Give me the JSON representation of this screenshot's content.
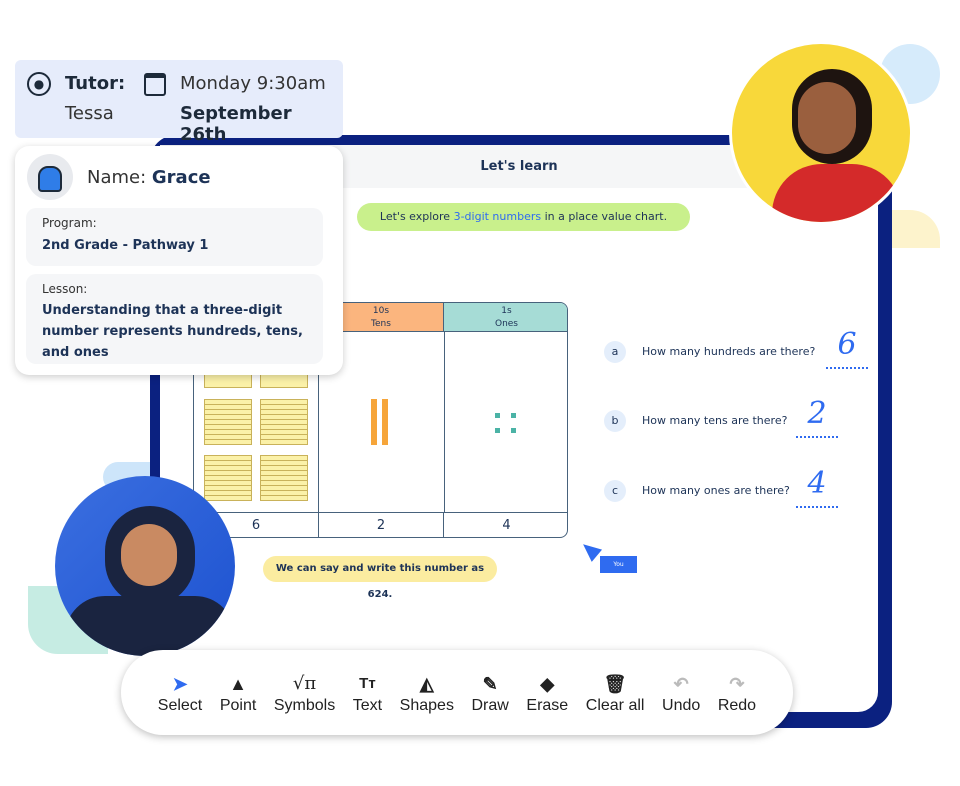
{
  "tutor": {
    "label": "Tutor:",
    "name": "Tessa",
    "day_time": "Monday 9:30am",
    "date": "September 26th"
  },
  "student": {
    "name_label": "Name:",
    "name": "Grace",
    "program_label": "Program:",
    "program": "2nd Grade - Pathway 1",
    "lesson_label": "Lesson:",
    "lesson": "Understanding that a three-digit number represents hundreds, tens, and ones"
  },
  "board": {
    "title": "Let's learn",
    "intro_before": "Let's explore ",
    "intro_highlight": "3-digit numbers",
    "intro_after": " in a place value chart.",
    "summary": "We can say and write this number as 624.",
    "cursor_label": "You",
    "columns": [
      {
        "place": "10s",
        "name": "Tens",
        "value": "2"
      },
      {
        "place": "1s",
        "name": "Ones",
        "value": "4"
      }
    ],
    "hundreds_value": "6",
    "questions": [
      {
        "letter": "a",
        "text": "How many hundreds are there?",
        "answer": "6"
      },
      {
        "letter": "b",
        "text": "How many tens are there?",
        "answer": "2"
      },
      {
        "letter": "c",
        "text": "How many ones are there?",
        "answer": "4"
      }
    ]
  },
  "toolbar": [
    {
      "label": "Select",
      "icon": "cursor-arrow"
    },
    {
      "label": "Point",
      "icon": "pointer"
    },
    {
      "label": "Symbols",
      "icon": "sqrt-pi"
    },
    {
      "label": "Text",
      "icon": "text-size"
    },
    {
      "label": "Shapes",
      "icon": "shapes"
    },
    {
      "label": "Draw",
      "icon": "pencil"
    },
    {
      "label": "Erase",
      "icon": "eraser"
    },
    {
      "label": "Clear all",
      "icon": "trash"
    },
    {
      "label": "Undo",
      "icon": "undo"
    },
    {
      "label": "Redo",
      "icon": "redo"
    }
  ],
  "colors": {
    "frame": "#0b2180",
    "accent": "#2f6bf0",
    "tens": "#fbb57e",
    "ones": "#a6dcd6",
    "intro_pill": "#c9f08c",
    "summary_pill": "#fbeca0"
  }
}
